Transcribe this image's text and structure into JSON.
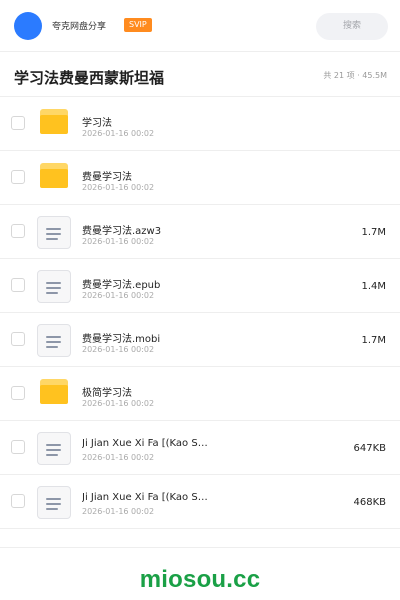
{
  "header": {
    "user_name": "夸克网盘分享",
    "badge": "SVIP",
    "search_placeholder": "搜索",
    "avatar_color": "#2b7bff"
  },
  "share": {
    "title": "学习法费曼西蒙斯坦福",
    "summary": "共 21 项 · 45.5M"
  },
  "files": [
    {
      "type": "folder",
      "name": "学习法",
      "date": "2026-01-16 00:02",
      "size": ""
    },
    {
      "type": "folder",
      "name": "费曼学习法",
      "date": "2026-01-16 00:02",
      "size": ""
    },
    {
      "type": "file",
      "name": "费曼学习法.azw3",
      "date": "2026-01-16 00:02",
      "size": "1.7M"
    },
    {
      "type": "file",
      "name": "费曼学习法.epub",
      "date": "2026-01-16 00:02",
      "size": "1.4M"
    },
    {
      "type": "file",
      "name": "费曼学习法.mobi",
      "date": "2026-01-16 00:02",
      "size": "1.7M"
    },
    {
      "type": "folder",
      "name": "极简学习法",
      "date": "2026-01-16 00:02",
      "size": ""
    },
    {
      "type": "file",
      "name": "Ji Jian Xue Xi Fa [(Kao S…",
      "date": "2026-01-16 00:02",
      "size": "647KB"
    },
    {
      "type": "file",
      "name": "Ji Jian Xue Xi Fa [(Kao S…",
      "date": "2026-01-16 00:02",
      "size": "468KB"
    }
  ],
  "watermark": "miosou.cc",
  "colors": {
    "svip": "#ff8b1f",
    "folder": "#ffc21f",
    "watermark": "#1aa046"
  }
}
